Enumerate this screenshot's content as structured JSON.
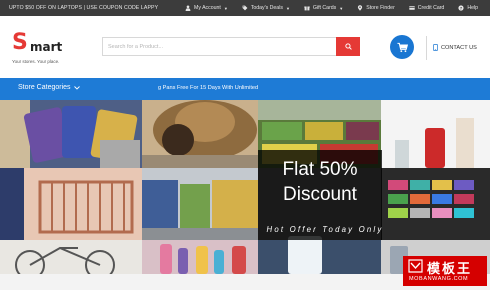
{
  "topbar": {
    "promo": "UPTO $50 OFF ON LAPTOPS | USE COUPON CODE LAPPY",
    "links": [
      {
        "label": "My Account",
        "icon": "user-icon",
        "caret": true
      },
      {
        "label": "Today's Deals",
        "icon": "tag-icon",
        "caret": true
      },
      {
        "label": "Gift Cards",
        "icon": "gift-icon",
        "caret": true
      },
      {
        "label": "Store Finder",
        "icon": "map-marker-icon",
        "caret": false
      },
      {
        "label": "Credit Card",
        "icon": "credit-card-icon",
        "caret": false
      },
      {
        "label": "Help",
        "icon": "help-icon",
        "caret": false
      }
    ]
  },
  "header": {
    "logo_initial": "S",
    "logo_rest": "mart",
    "logo_tagline": "Your stores. Your place.",
    "search_placeholder": "Search for a Product...",
    "contact_label": "CONTACT US"
  },
  "nav": {
    "categories_label": "Store Categories",
    "ticker": "g Pans Free For 15 Days With Unlimited"
  },
  "banner": {
    "headline_line1": "Flat 50%",
    "headline_line2": "Discount",
    "offer": "Hot Offer Today Only"
  },
  "watermark": {
    "text_cn": "模板王",
    "text_en": "MOBANWANG.COM"
  },
  "colors": {
    "topbar": "#3c3c3c",
    "accent_red": "#e53935",
    "nav_blue": "#1e7bd6",
    "cart_blue": "#1976d2"
  }
}
